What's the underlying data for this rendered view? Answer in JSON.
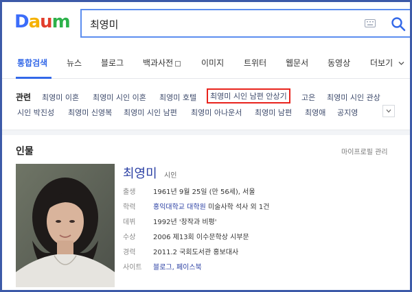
{
  "logo": {
    "letters": [
      "D",
      "a",
      "u",
      "m"
    ],
    "colors": [
      "#3c6dfa",
      "#f5b100",
      "#e23e2c",
      "#2cb14a"
    ]
  },
  "search": {
    "value": "최영미"
  },
  "tabs": [
    {
      "label": "통합검색",
      "active": true
    },
    {
      "label": "뉴스"
    },
    {
      "label": "블로그"
    },
    {
      "label": "백과사전"
    },
    {
      "label": "이미지"
    },
    {
      "label": "트위터"
    },
    {
      "label": "웹문서"
    },
    {
      "label": "동영상"
    },
    {
      "label": "더보기"
    }
  ],
  "related": {
    "label": "관련",
    "row1": [
      "최영미 이혼",
      "최영미 시인 이혼",
      "최영미 호텔",
      "최영미 시인 남편 안상기",
      "고은",
      "최영미 시인 관상"
    ],
    "row2": [
      "시인 박진성",
      "최영미 신영복",
      "최영미 시인 남편",
      "최영미 아나운서",
      "최영미 남편",
      "최영애",
      "공지영"
    ]
  },
  "person_section": {
    "title": "인물",
    "profile_manage": "마이프로필 관리",
    "name": "최영미",
    "role": "시인",
    "info": [
      {
        "key": "출생",
        "value": "1961년 9월 25일 (만 56세), 서울"
      },
      {
        "key": "학력",
        "value": "홍익대학교 대학원",
        "value2": "미술사학 석사 외 1건"
      },
      {
        "key": "데뷔",
        "value": "1992년 '창작과 비평'"
      },
      {
        "key": "수상",
        "value": "2006 제13회 이수문학상 시부문"
      },
      {
        "key": "경력",
        "value": "2011.2 국회도서관 홍보대사"
      },
      {
        "key": "사이트",
        "value": "블로그, 페이스북"
      }
    ]
  },
  "colors": {
    "accent": "#3368e8",
    "highlight_border": "#e8221b",
    "name_color": "#2a3fa3"
  }
}
